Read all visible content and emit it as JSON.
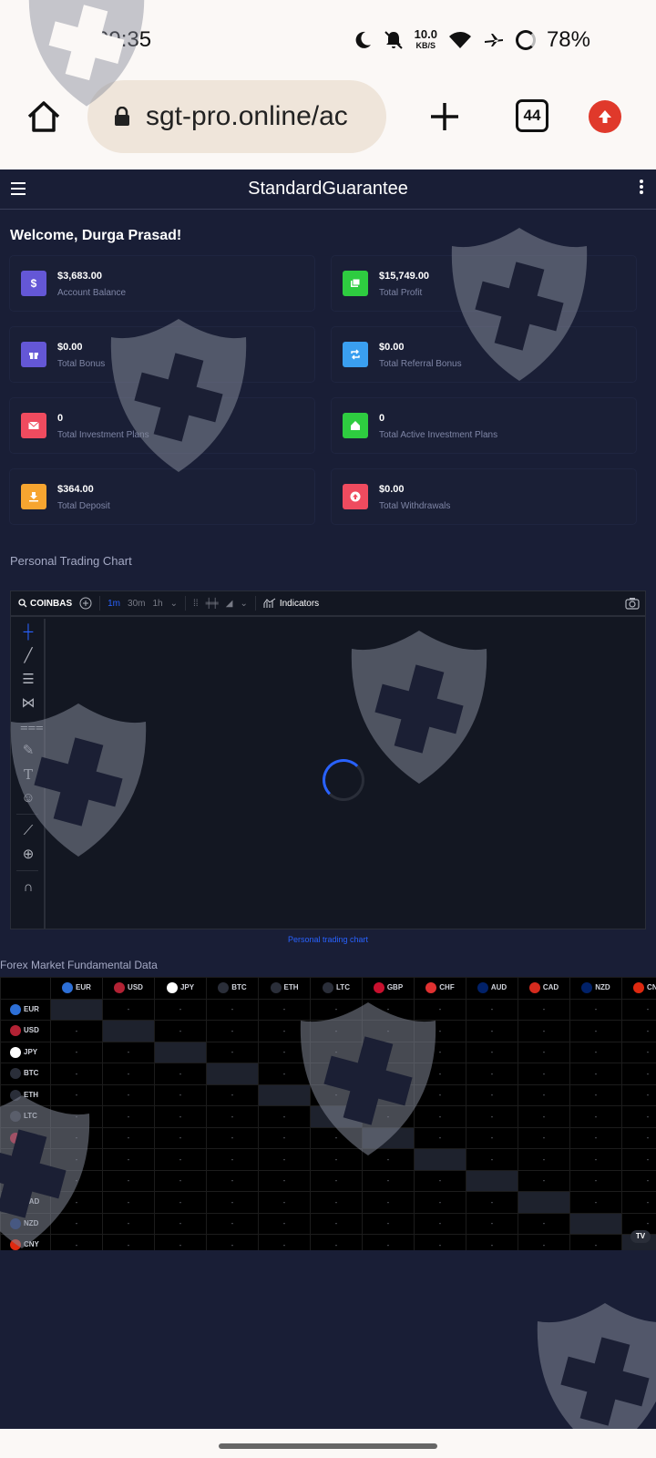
{
  "status_bar": {
    "time": "09:35",
    "net_speed": "10.0",
    "net_unit": "KB/S",
    "battery": "78%"
  },
  "browser": {
    "url": "sgt-pro.online/ac",
    "tab_count": "44"
  },
  "app": {
    "title": "StandardGuarantee",
    "welcome": "Welcome, Durga Prasad!"
  },
  "cards": [
    {
      "value": "$3,683.00",
      "label": "Account Balance",
      "icon": "dollar-icon",
      "color": "#6457d6"
    },
    {
      "value": "$15,749.00",
      "label": "Total Profit",
      "icon": "money-icon",
      "color": "#2ecc40"
    },
    {
      "value": "$0.00",
      "label": "Total Bonus",
      "icon": "gift-icon",
      "color": "#6457d6"
    },
    {
      "value": "$0.00",
      "label": "Total Referral Bonus",
      "icon": "retweet-icon",
      "color": "#3a9ff0"
    },
    {
      "value": "0",
      "label": "Total Investment Plans",
      "icon": "envelope-icon",
      "color": "#ef4b5f"
    },
    {
      "value": "0",
      "label": "Total Active Investment Plans",
      "icon": "house-icon",
      "color": "#2ecc40"
    },
    {
      "value": "$364.00",
      "label": "Total Deposit",
      "icon": "download-icon",
      "color": "#f7a530"
    },
    {
      "value": "$0.00",
      "label": "Total Withdrawals",
      "icon": "arrow-up-circle-icon",
      "color": "#ef4b5f"
    }
  ],
  "trading": {
    "section_title": "Personal Trading Chart",
    "symbol": "COINBAS",
    "intervals": [
      "1m",
      "30m",
      "1h"
    ],
    "indicators_label": "Indicators",
    "caption": "Personal trading chart"
  },
  "forex": {
    "title": "Forex Market Fundamental Data",
    "currencies": [
      "EUR",
      "USD",
      "JPY",
      "BTC",
      "ETH",
      "LTC",
      "GBP",
      "CHF",
      "AUD",
      "CAD",
      "NZD",
      "CNY"
    ],
    "empty_cell": "-",
    "badge": "TV"
  },
  "colors": {
    "app_bg": "#191e36",
    "chart_bg": "#131722",
    "accent": "#2962ff"
  }
}
